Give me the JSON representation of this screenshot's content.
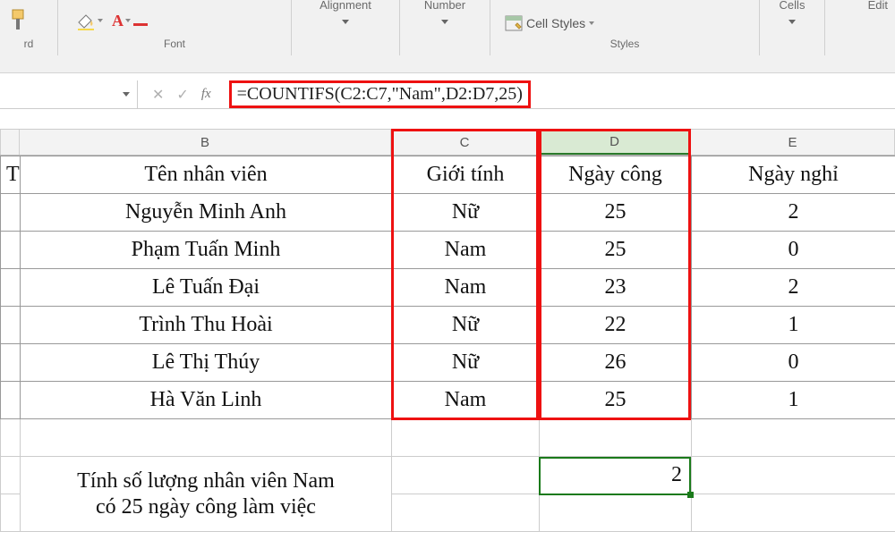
{
  "ribbon": {
    "clipboard_label": "rd",
    "font_label": "Font",
    "alignment_label": "Alignment",
    "number_label": "Number",
    "styles_label": "Styles",
    "cells_label": "Cells",
    "editing_label": "Edit",
    "cell_styles": "Cell Styles"
  },
  "formula_bar": {
    "cancel_icon": "✕",
    "enter_icon": "✓",
    "fx": "fx",
    "formula": "=COUNTIFS(C2:C7,\"Nam\",D2:D7,25)"
  },
  "columns": [
    "B",
    "C",
    "D",
    "E"
  ],
  "selected_column": "D",
  "table": {
    "col_A_frag": "T",
    "headers": {
      "b": "Tên nhân viên",
      "c": "Giới tính",
      "d": "Ngày công",
      "e": "Ngày nghỉ"
    },
    "rows": [
      {
        "b": "Nguyễn Minh Anh",
        "c": "Nữ",
        "d": "25",
        "e": "2"
      },
      {
        "b": "Phạm Tuấn Minh",
        "c": "Nam",
        "d": "25",
        "e": "0"
      },
      {
        "b": "Lê Tuấn Đại",
        "c": "Nam",
        "d": "23",
        "e": "2"
      },
      {
        "b": "Trình Thu Hoài",
        "c": "Nữ",
        "d": "22",
        "e": "1"
      },
      {
        "b": "Lê Thị Thúy",
        "c": "Nữ",
        "d": "26",
        "e": "0"
      },
      {
        "b": "Hà Văn Linh",
        "c": "Nam",
        "d": "25",
        "e": "1"
      }
    ],
    "note_line1": "Tính số lượng nhân viên Nam",
    "note_line2": "có 25 ngày công làm việc",
    "result": "2"
  }
}
